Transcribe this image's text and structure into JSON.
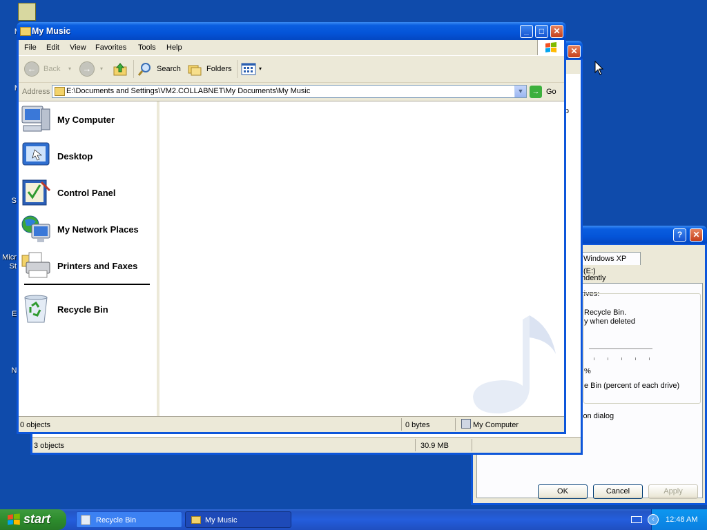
{
  "desktop": {
    "labels": [
      "M",
      "M",
      "Su",
      "Micro",
      "Stu",
      "Ev",
      "Nc"
    ]
  },
  "dialog": {
    "tab_label": "Windows XP (E:)",
    "independently_text": "ndently",
    "drives_label": "rives:",
    "recycle_text": "Recycle Bin.",
    "deleted_text": "y when deleted",
    "percent_text": "%",
    "bin_percent_text": "e Bin (percent of each drive)",
    "confirm_text": "ion dialog",
    "ok_label": "OK",
    "cancel_label": "Cancel",
    "apply_label": "Apply"
  },
  "recycle_window": {
    "column_hint": "p",
    "status_objects": "3 objects",
    "status_size": "30.9 MB"
  },
  "mymusic": {
    "title": "My Music",
    "menu": [
      "File",
      "Edit",
      "View",
      "Favorites",
      "Tools",
      "Help"
    ],
    "toolbar": {
      "back": "Back",
      "search": "Search",
      "folders": "Folders"
    },
    "address_label": "Address",
    "address_path": "E:\\Documents and Settings\\VM2.COLLABNET\\My Documents\\My Music",
    "go_label": "Go",
    "nav_items": [
      "My Computer",
      "Desktop",
      "Control Panel",
      "My Network Places",
      "Printers and Faxes",
      "Recycle Bin"
    ],
    "status": {
      "objects": "0 objects",
      "bytes": "0 bytes",
      "location": "My Computer"
    }
  },
  "taskbar": {
    "start_label": "start",
    "tasks": [
      "Recycle Bin",
      "My Music"
    ],
    "clock": "12:48 AM"
  },
  "colors": {
    "desktop": "#0f4bab",
    "titlebar": "#0454d8",
    "face": "#ece9d8",
    "start": "#2d8c2d"
  }
}
